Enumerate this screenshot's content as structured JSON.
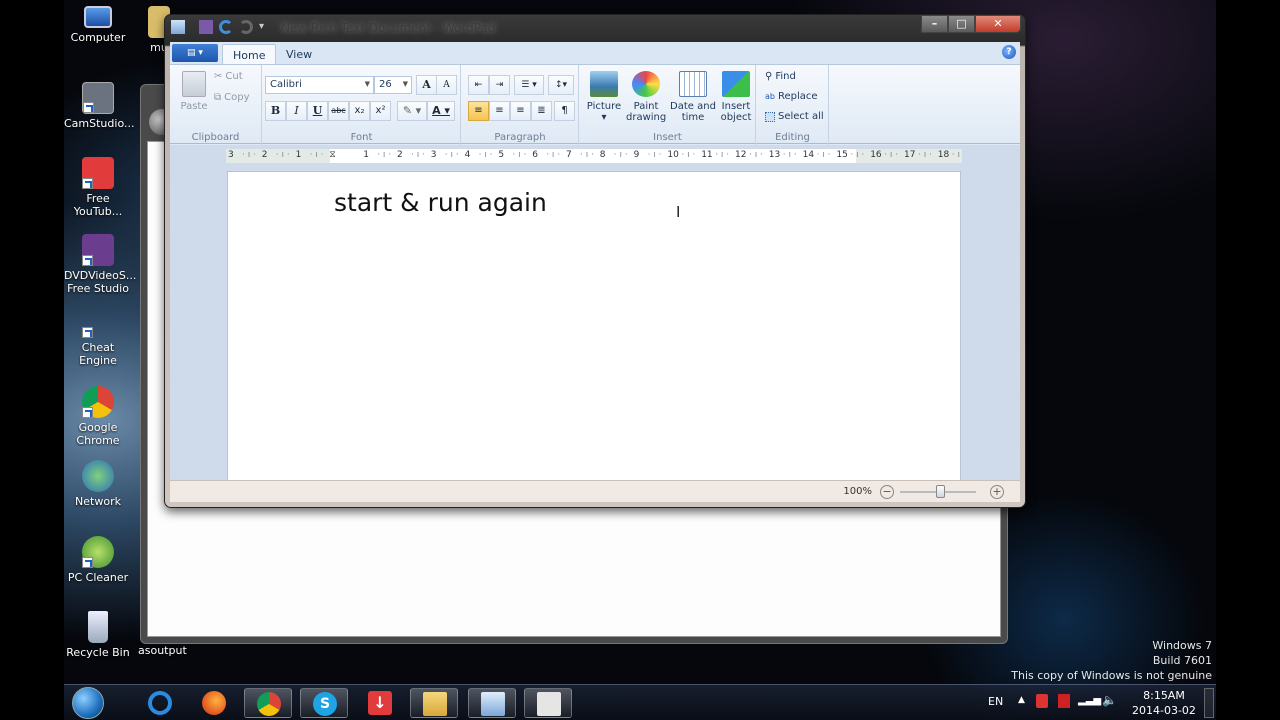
{
  "desktop": {
    "icons": [
      {
        "label": "Computer",
        "icon": "computer-icon"
      },
      {
        "label": "CamStudio...",
        "icon": "camstudio-icon"
      },
      {
        "label": "Free YouTub...",
        "icon": "free-youtube-downloader-icon"
      },
      {
        "label": "DVDVideoS... Free Studio",
        "icon": "dvdvideosoft-icon"
      },
      {
        "label": "Cheat Engine",
        "icon": "cheat-engine-icon"
      },
      {
        "label": "Google Chrome",
        "icon": "chrome-icon"
      },
      {
        "label": "Network",
        "icon": "network-icon"
      },
      {
        "label": "PC Cleaner",
        "icon": "pc-cleaner-icon"
      },
      {
        "label": "Recycle Bin",
        "icon": "recycle-bin-icon"
      }
    ],
    "partial_labels": {
      "folder": "mu",
      "bg_window_caption": "asoutput"
    },
    "watermark": [
      "Windows 7",
      "Build 7601",
      "This copy of Windows is not genuine"
    ]
  },
  "wordpad": {
    "title": "New Rich Text Document - WordPad",
    "tabs": [
      {
        "label": "Home",
        "active": true
      },
      {
        "label": "View",
        "active": false
      }
    ],
    "help": "?",
    "ribbon": {
      "clipboard": {
        "label": "Clipboard",
        "paste": "Paste",
        "cut": "Cut",
        "copy": "Copy"
      },
      "font": {
        "label": "Font",
        "family": "Calibri",
        "size": "26",
        "grow": "A",
        "shrink": "A",
        "bold": "B",
        "italic": "I",
        "underline": "U",
        "strikethrough": "abc",
        "subscript": "x₂",
        "superscript": "x²",
        "highlight": "✎",
        "color": "A",
        "color_value": "#000000"
      },
      "paragraph": {
        "label": "Paragraph"
      },
      "insert": {
        "label": "Insert",
        "picture": "Picture",
        "paint_l1": "Paint",
        "paint_l2": "drawing",
        "date_l1": "Date and",
        "date_l2": "time",
        "object_l1": "Insert",
        "object_l2": "object"
      },
      "editing": {
        "label": "Editing",
        "find": "Find",
        "replace": "Replace",
        "select_all": "Select all"
      }
    },
    "ruler": [
      "3",
      "2",
      "1",
      "1",
      "2",
      "3",
      "4",
      "5",
      "6",
      "7",
      "8",
      "9",
      "10",
      "11",
      "12",
      "13",
      "14",
      "15",
      "16",
      "17",
      "18"
    ],
    "document": {
      "text": "start & run again"
    },
    "status": {
      "zoom": "100%",
      "zoom_level_percent": 100
    }
  },
  "taskbar": {
    "apps": [
      "internet-explorer",
      "firefox",
      "chrome",
      "skype",
      "free-youtube-downloader",
      "windows-explorer",
      "wordpad",
      "camstudio"
    ],
    "tray": {
      "lang": "EN",
      "time": "8:15AM",
      "date": "2014-03-02"
    }
  }
}
